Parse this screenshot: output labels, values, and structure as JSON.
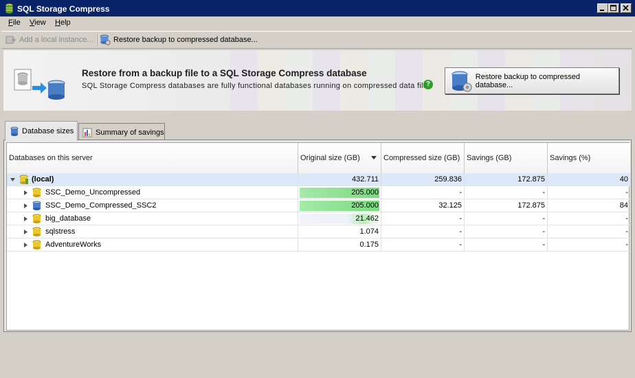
{
  "window": {
    "title": "SQL Storage Compress"
  },
  "menubar": {
    "items": [
      {
        "label": "File",
        "accel": "F",
        "rest": "ile"
      },
      {
        "label": "View",
        "accel": "V",
        "rest": "iew"
      },
      {
        "label": "Help",
        "accel": "H",
        "rest": "elp"
      }
    ]
  },
  "toolbar": {
    "add_instance": "Add a local instance...",
    "restore_backup": "Restore backup to compressed database..."
  },
  "banner": {
    "title": "Restore from a backup file to a SQL Storage Compress database",
    "description": "SQL Storage Compress databases are fully functional databases running on compressed data files",
    "help_glyph": "?",
    "button_label": "Restore backup to compressed database..."
  },
  "tabs": [
    {
      "label": "Database sizes",
      "active": true
    },
    {
      "label": "Summary of savings",
      "active": false
    }
  ],
  "grid": {
    "columns": [
      "Databases on this server",
      "Original size (GB)",
      "Compressed size (GB)",
      "Savings (GB)",
      "Savings (%)"
    ],
    "root": {
      "name": "(local)",
      "original": "432.711",
      "compressed": "259.836",
      "savings_gb": "172.875",
      "savings_pct": "40"
    },
    "rows": [
      {
        "name": "SSC_Demo_Uncompressed",
        "original": "205.000",
        "compressed": "-",
        "savings_gb": "-",
        "savings_pct": "-",
        "icon": "db-yellow-icon",
        "fill": 1.0
      },
      {
        "name": "SSC_Demo_Compressed_SSC2",
        "original": "205.000",
        "compressed": "32.125",
        "savings_gb": "172.875",
        "savings_pct": "84",
        "icon": "db-blue-icon",
        "fill": 1.0
      },
      {
        "name": "big_database",
        "original": "21.462",
        "compressed": "-",
        "savings_gb": "-",
        "savings_pct": "-",
        "icon": "db-yellow-icon",
        "fill": 0.105
      },
      {
        "name": "sqlstress",
        "original": "1.074",
        "compressed": "-",
        "savings_gb": "-",
        "savings_pct": "-",
        "icon": "db-yellow-icon",
        "fill": 0.005
      },
      {
        "name": "AdventureWorks",
        "original": "0.175",
        "compressed": "-",
        "savings_gb": "-",
        "savings_pct": "-",
        "icon": "db-yellow-icon",
        "fill": 0.001
      }
    ]
  },
  "colors": {
    "titlebar": "#0a246a",
    "root_row": "#dde8f7",
    "bar_green": "#7ada7e"
  }
}
